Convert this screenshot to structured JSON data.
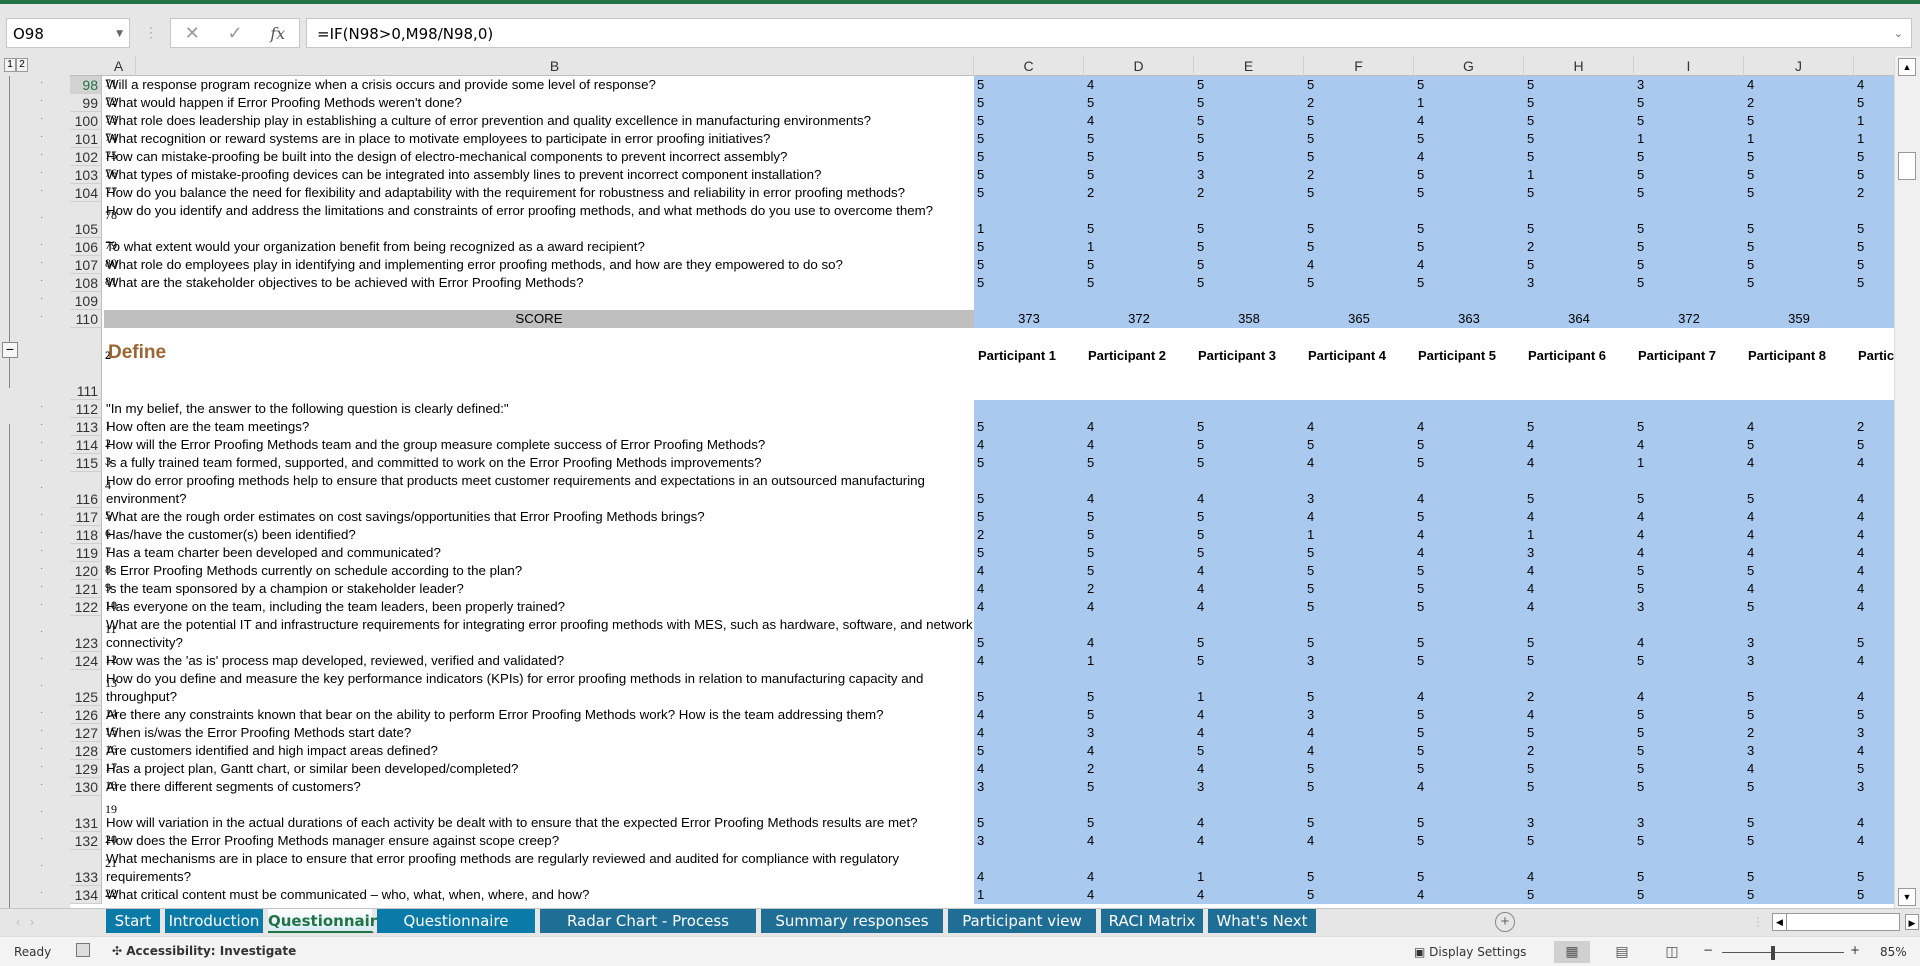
{
  "namebox": "O98",
  "formula": "=IF(N98>0,M98/N98,0)",
  "outline_levels": [
    "1",
    "2"
  ],
  "columns": [
    "A",
    "B",
    "C",
    "D",
    "E",
    "F",
    "G",
    "H",
    "I",
    "J"
  ],
  "section1_rows": [
    {
      "row": "98",
      "num": "71",
      "q": "Will a response program recognize when a crisis occurs and provide some level of response?",
      "v": [
        5,
        4,
        5,
        5,
        5,
        5,
        3,
        4,
        4
      ]
    },
    {
      "row": "99",
      "num": "72",
      "q": "What would happen if Error Proofing Methods weren't done?",
      "v": [
        5,
        5,
        5,
        2,
        1,
        5,
        5,
        2,
        5
      ]
    },
    {
      "row": "100",
      "num": "73",
      "q": "What role does leadership play in establishing a culture of error prevention and quality excellence in manufacturing environments?",
      "v": [
        5,
        4,
        5,
        5,
        4,
        5,
        5,
        5,
        1
      ]
    },
    {
      "row": "101",
      "num": "74",
      "q": "What recognition or reward systems are in place to motivate employees to participate in error proofing initiatives?",
      "v": [
        5,
        5,
        5,
        5,
        5,
        5,
        1,
        1,
        1
      ]
    },
    {
      "row": "102",
      "num": "75",
      "q": "How can mistake-proofing be built into the design of electro-mechanical components to prevent incorrect assembly?",
      "v": [
        5,
        5,
        5,
        5,
        4,
        5,
        5,
        5,
        5
      ]
    },
    {
      "row": "103",
      "num": "76",
      "q": "What types of mistake-proofing devices can be integrated into assembly lines to prevent incorrect component installation?",
      "v": [
        5,
        5,
        3,
        2,
        5,
        1,
        5,
        5,
        5
      ]
    },
    {
      "row": "104",
      "num": "77",
      "q": "How do you balance the need for flexibility and adaptability with the requirement for robustness and reliability in error proofing methods?",
      "v": [
        5,
        2,
        2,
        5,
        5,
        5,
        5,
        5,
        2
      ]
    },
    {
      "row": "105",
      "num": "78",
      "q": "How do you identify and address the limitations and constraints of error proofing methods, and what methods do you use to overcome them?",
      "v": [
        1,
        5,
        5,
        5,
        5,
        5,
        5,
        5,
        5
      ],
      "tall": true
    },
    {
      "row": "106",
      "num": "79",
      "q": "To what extent would your organization benefit from being recognized as a award recipient?",
      "v": [
        5,
        1,
        5,
        5,
        5,
        2,
        5,
        5,
        5
      ]
    },
    {
      "row": "107",
      "num": "80",
      "q": "What role do employees play in identifying and implementing error proofing methods, and how are they empowered to do so?",
      "v": [
        5,
        5,
        5,
        4,
        4,
        5,
        5,
        5,
        5
      ]
    },
    {
      "row": "108",
      "num": "81",
      "q": "What are the stakeholder objectives to be achieved with Error Proofing Methods?",
      "v": [
        5,
        5,
        5,
        5,
        5,
        3,
        5,
        5,
        5
      ]
    }
  ],
  "blank_row": "109",
  "score": {
    "row": "110",
    "label": "SCORE",
    "values": [
      373,
      372,
      358,
      365,
      363,
      364,
      372,
      359
    ]
  },
  "define": {
    "row": "111",
    "section_num": "2",
    "title": "Define",
    "participants": [
      "Participant 1",
      "Participant 2",
      "Participant 3",
      "Participant 4",
      "Participant 5",
      "Participant 6",
      "Participant 7",
      "Participant 8",
      "Partic"
    ]
  },
  "intro": {
    "row": "112",
    "text": "\"In my belief, the answer to the following question is clearly defined:\""
  },
  "section2_rows": [
    {
      "row": "113",
      "num": "1",
      "q": "How often are the team meetings?",
      "v": [
        5,
        4,
        5,
        4,
        4,
        5,
        5,
        4,
        2
      ]
    },
    {
      "row": "114",
      "num": "2",
      "q": "How will the Error Proofing Methods team and the group measure complete success of Error Proofing Methods?",
      "v": [
        4,
        4,
        5,
        5,
        5,
        4,
        4,
        5,
        5
      ]
    },
    {
      "row": "115",
      "num": "3",
      "q": "Is a fully trained team formed, supported, and committed to work on the Error Proofing Methods improvements?",
      "v": [
        5,
        5,
        5,
        4,
        5,
        4,
        1,
        4,
        4
      ]
    },
    {
      "row": "116",
      "num": "4",
      "q": "How do error proofing methods help to ensure that products meet customer requirements and expectations in an outsourced manufacturing environment?",
      "v": [
        5,
        4,
        4,
        3,
        4,
        5,
        5,
        5,
        4
      ],
      "tall": true
    },
    {
      "row": "117",
      "num": "5",
      "q": "What are the rough order estimates on cost savings/opportunities that Error Proofing Methods brings?",
      "v": [
        5,
        5,
        5,
        4,
        5,
        4,
        4,
        4,
        4
      ]
    },
    {
      "row": "118",
      "num": "6",
      "q": "Has/have the customer(s) been identified?",
      "v": [
        2,
        5,
        5,
        1,
        4,
        1,
        4,
        4,
        4
      ]
    },
    {
      "row": "119",
      "num": "7",
      "q": "Has a team charter been developed and communicated?",
      "v": [
        5,
        5,
        5,
        5,
        4,
        3,
        4,
        4,
        4
      ]
    },
    {
      "row": "120",
      "num": "8",
      "q": "Is Error Proofing Methods currently on schedule according to the plan?",
      "v": [
        4,
        5,
        4,
        5,
        5,
        4,
        5,
        5,
        4
      ]
    },
    {
      "row": "121",
      "num": "9",
      "q": "Is the team sponsored by a champion or stakeholder leader?",
      "v": [
        4,
        2,
        4,
        5,
        5,
        4,
        5,
        4,
        4
      ]
    },
    {
      "row": "122",
      "num": "10",
      "q": "Has everyone on the team, including the team leaders, been properly trained?",
      "v": [
        4,
        4,
        4,
        5,
        5,
        4,
        3,
        5,
        4
      ]
    },
    {
      "row": "123",
      "num": "11",
      "q": "What are the potential IT and infrastructure requirements for integrating error proofing methods with MES, such as hardware, software, and network connectivity?",
      "v": [
        5,
        4,
        5,
        5,
        5,
        5,
        4,
        3,
        5
      ],
      "tall": true
    },
    {
      "row": "124",
      "num": "12",
      "q": "How was the 'as is' process map developed, reviewed, verified and validated?",
      "v": [
        4,
        1,
        5,
        3,
        5,
        5,
        5,
        3,
        4
      ]
    },
    {
      "row": "125",
      "num": "13",
      "q": "How do you define and measure the key performance indicators (KPIs) for error proofing methods in relation to manufacturing capacity and throughput?",
      "v": [
        5,
        5,
        1,
        5,
        4,
        2,
        4,
        5,
        4
      ],
      "tall": true
    },
    {
      "row": "126",
      "num": "14",
      "q": "Are there any constraints known that bear on the ability to perform Error Proofing Methods work? How is the team addressing them?",
      "v": [
        4,
        5,
        4,
        3,
        5,
        4,
        5,
        5,
        5
      ]
    },
    {
      "row": "127",
      "num": "15",
      "q": "When is/was the Error Proofing Methods start date?",
      "v": [
        4,
        3,
        4,
        4,
        5,
        5,
        5,
        2,
        3
      ]
    },
    {
      "row": "128",
      "num": "16",
      "q": "Are customers identified and high impact areas defined?",
      "v": [
        5,
        4,
        5,
        4,
        5,
        2,
        5,
        3,
        4
      ]
    },
    {
      "row": "129",
      "num": "17",
      "q": "Has a project plan, Gantt chart, or similar been developed/completed?",
      "v": [
        4,
        2,
        4,
        5,
        5,
        5,
        5,
        4,
        5
      ]
    },
    {
      "row": "130",
      "num": "18",
      "q": "Are there different segments of customers?",
      "v": [
        3,
        5,
        3,
        5,
        4,
        5,
        5,
        5,
        3
      ]
    },
    {
      "row": "131",
      "num": "19",
      "q": "How will variation in the actual durations of each activity be dealt with to ensure that the expected Error Proofing Methods results are met?",
      "v": [
        5,
        5,
        4,
        5,
        5,
        3,
        3,
        5,
        4
      ],
      "tall": true,
      "singleline": true
    },
    {
      "row": "132",
      "num": "20",
      "q": "How does the Error Proofing Methods manager ensure against scope creep?",
      "v": [
        3,
        4,
        4,
        4,
        5,
        5,
        5,
        5,
        4
      ]
    },
    {
      "row": "133",
      "num": "21",
      "q": "What mechanisms are in place to ensure that error proofing methods are regularly reviewed and audited for compliance with regulatory requirements?",
      "v": [
        4,
        4,
        1,
        5,
        5,
        4,
        5,
        5,
        5
      ],
      "tall": true
    },
    {
      "row": "134",
      "num": "22",
      "q": "What critical content must be communicated – who, what, when, where, and how?",
      "v": [
        1,
        4,
        4,
        5,
        4,
        5,
        5,
        5,
        5
      ]
    }
  ],
  "sheet_tabs": [
    {
      "label": "Start",
      "state": "normal"
    },
    {
      "label": "Introduction",
      "state": "normal"
    },
    {
      "label": "Questionnaire",
      "state": "active"
    },
    {
      "label": "Questionnaire results",
      "state": "normal"
    },
    {
      "label": "Radar Chart - Process Average",
      "state": "dark"
    },
    {
      "label": "Summary responses",
      "state": "dark"
    },
    {
      "label": "Participant view",
      "state": "dark"
    },
    {
      "label": "RACI Matrix",
      "state": "dark"
    },
    {
      "label": "What's Next",
      "state": "dark"
    }
  ],
  "status": {
    "ready": "Ready",
    "accessibility": "Accessibility: Investigate",
    "display_settings": "Display Settings",
    "zoom": "85%"
  },
  "colors": {
    "accent": "#217346",
    "data_fill": "#a9c9ee",
    "score_fill": "#bfbfbf",
    "section_title": "#9c6632",
    "tab_blue": "#0a7aa8",
    "tab_dark": "#1e6e96"
  }
}
